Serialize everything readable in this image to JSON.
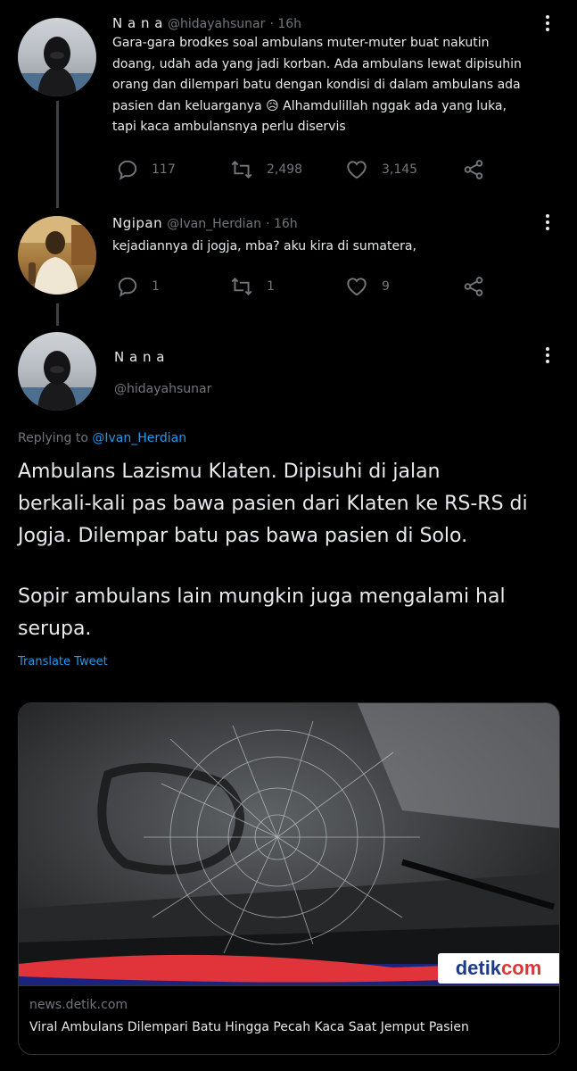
{
  "tweet1": {
    "name": "N a n a",
    "handle": "@hidayahsunar",
    "time": "· 16h",
    "lines": [
      "Gara-gara brodkes soal ambulans muter-muter buat nakutin",
      "doang, udah ada yang jadi korban. Ada ambulans lewat dipisuhin",
      "orang dan dilempari batu dengan kondisi di dalam ambulans ada",
      "pasien dan keluarganya",
      "Alhamdulillah nggak ada yang luka,",
      "tapi kaca ambulansnya perlu diservis"
    ],
    "emoji": "😥",
    "replies": "117",
    "retweets": "2,498",
    "likes": "3,145"
  },
  "tweet2": {
    "name": "Ngipan",
    "handle": "@Ivan_Herdian",
    "time": "· 16h",
    "text": "kejadiannya di jogja, mba? aku kira di sumatera,",
    "replies": "1",
    "retweets": "1",
    "likes": "9"
  },
  "main": {
    "name": "N a n a",
    "handle": "@hidayahsunar",
    "replying_prefix": "Replying to ",
    "replying_to": "@Ivan_Herdian",
    "lines": [
      "Ambulans Lazismu Klaten. Dipisuhi di jalan",
      "berkali-kali pas bawa pasien dari Klaten ke RS-RS di",
      "Jogja. Dilempar batu pas bawa pasien di Solo.",
      "Sopir ambulans lain mungkin juga mengalami hal",
      "serupa."
    ],
    "translate": "Translate Tweet"
  },
  "card": {
    "brand_a": "detik",
    "brand_b": "com",
    "domain": "news.detik.com",
    "title": "Viral Ambulans Dilempari Batu Hingga Pecah Kaca Saat Jemput Pasien"
  },
  "colors": {
    "accent": "#1d9bf0",
    "muted": "#71767b",
    "brand": "#e1343a"
  }
}
